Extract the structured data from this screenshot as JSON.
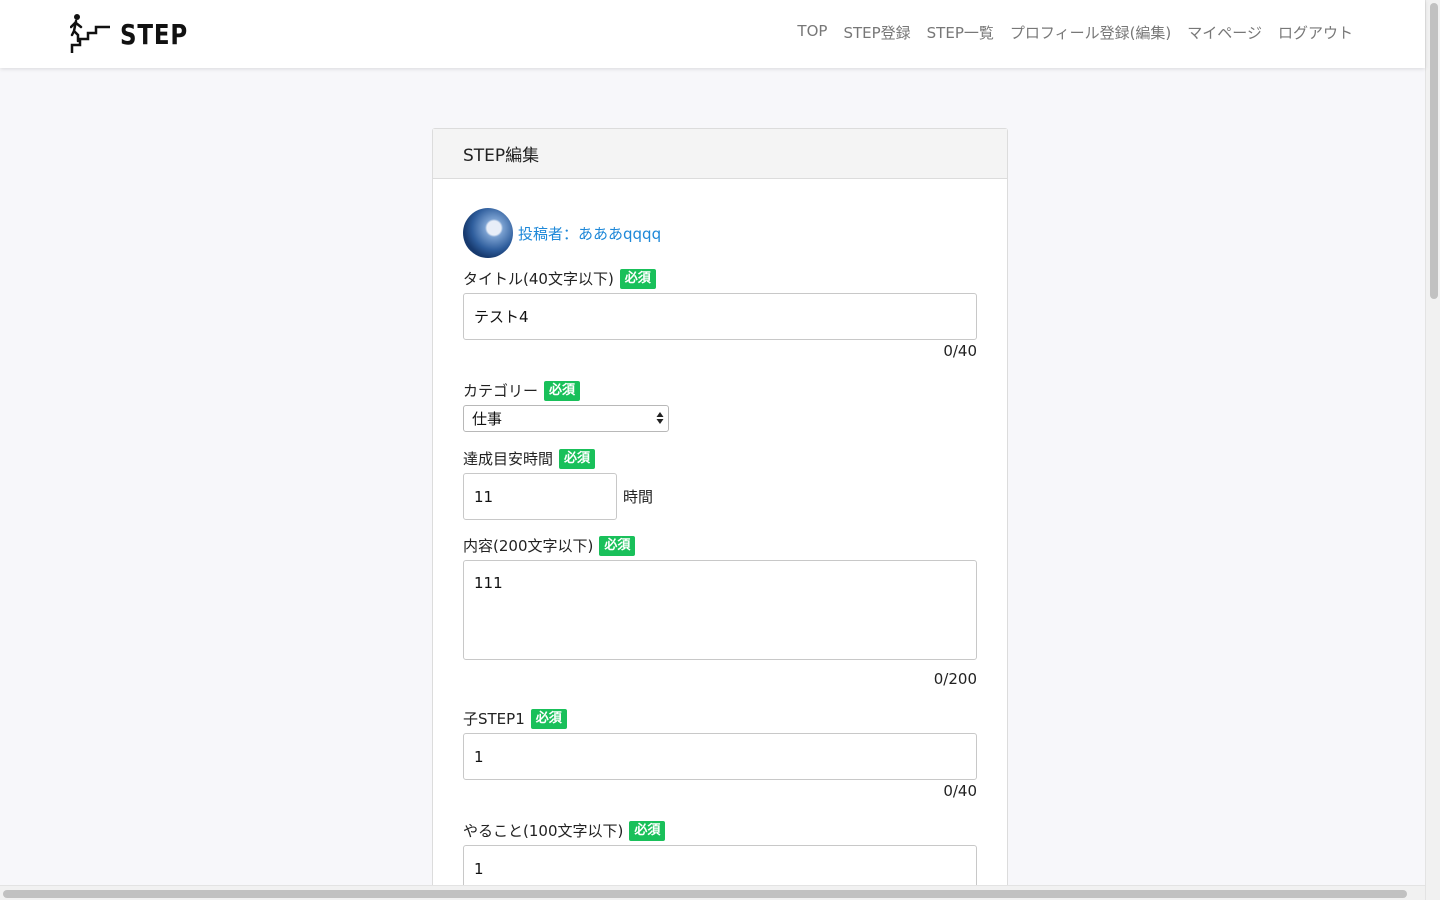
{
  "header": {
    "logo_text": "STEP",
    "logo_icon": "stairs-walker-icon",
    "nav": [
      "TOP",
      "STEP登録",
      "STEP一覧",
      "プロフィール登録(編集)",
      "マイページ",
      "ログアウト"
    ]
  },
  "card": {
    "title": "STEP編集",
    "author": "投稿者：あああqqqq",
    "required_badge": "必須",
    "fields": {
      "title": {
        "label": "タイトル(40文字以下)",
        "value": "テスト4",
        "counter": "0/40"
      },
      "category": {
        "label": "カテゴリー",
        "value": "仕事"
      },
      "hours": {
        "label": "達成目安時間",
        "value": "11",
        "unit": "時間"
      },
      "content": {
        "label": "内容(200文字以下)",
        "value": "111",
        "counter": "0/200"
      },
      "child_step": {
        "label": "子STEP1",
        "value": "1",
        "counter": "0/40"
      },
      "todo": {
        "label": "やること(100文字以下)",
        "value": "1"
      }
    }
  },
  "colors": {
    "accent_link": "#1e88d8",
    "required_badge": "#19c05a",
    "background": "#f7f7fa"
  }
}
